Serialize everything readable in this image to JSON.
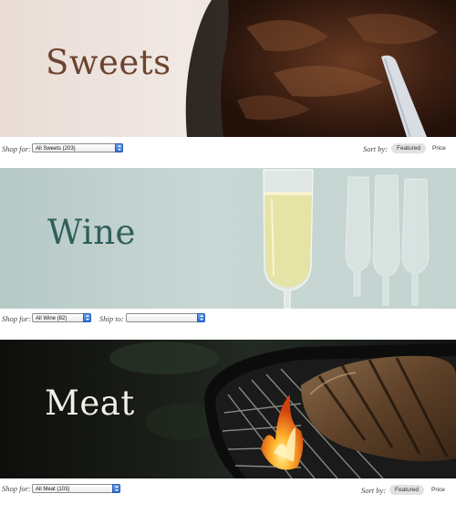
{
  "sections": [
    {
      "title": "Sweets",
      "title_color": "#6b4430",
      "shop_label": "Shop for:",
      "shop_value": "All Sweets (203)",
      "sort_label": "Sort by:",
      "sort_featured": "Featured",
      "sort_price": "Price"
    },
    {
      "title": "Wine",
      "title_color": "#2f5f5b",
      "shop_label": "Shop for:",
      "shop_value": "All Wine (82)",
      "ship_label": "Ship to:",
      "ship_value": ""
    },
    {
      "title": "Meat",
      "title_color": "#f4efe6",
      "shop_label": "Shop for:",
      "shop_value": "All Meat (103)",
      "sort_label": "Sort by:",
      "sort_featured": "Featured",
      "sort_price": "Price"
    }
  ],
  "colors": {
    "select_arrow": "#2f6fd6",
    "pill_bg": "#e2e2e2"
  }
}
